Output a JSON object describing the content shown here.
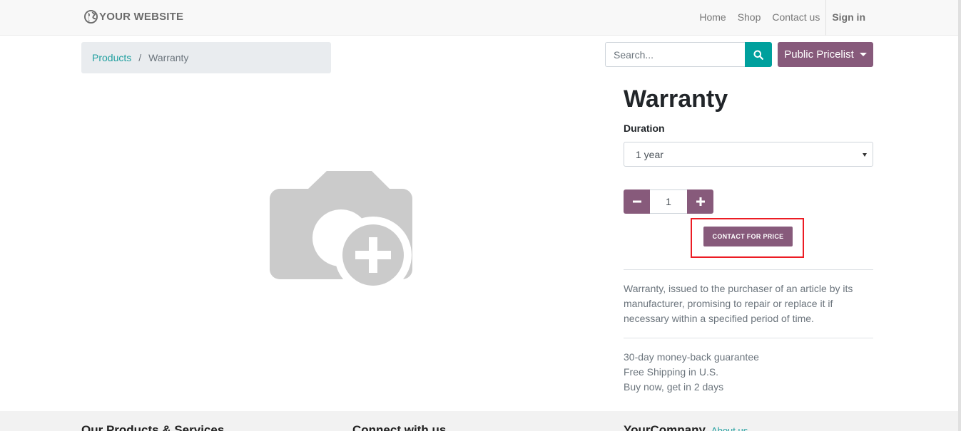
{
  "navbar": {
    "brand": "YOUR WEBSITE",
    "links": [
      "Home",
      "Shop",
      "Contact us"
    ],
    "signin": "Sign in"
  },
  "breadcrumb": {
    "parent": "Products",
    "separator": "/",
    "current": "Warranty"
  },
  "search": {
    "placeholder": "Search...",
    "value": ""
  },
  "pricelist": {
    "label": "Public Pricelist"
  },
  "product": {
    "title": "Warranty",
    "attribute_label": "Duration",
    "attribute_value": "1 year",
    "quantity": "1",
    "contact_label": "CONTACT FOR PRICE",
    "description": "Warranty, issued to the purchaser of an article by its manufacturer, promising to repair or replace it if necessary within a specified period of time.",
    "terms": [
      "30-day money-back guarantee",
      "Free Shipping in U.S.",
      "Buy now, get in 2 days"
    ]
  },
  "footer": {
    "col1": "Our Products & Services",
    "col2": "Connect with us",
    "col3": "YourCompany",
    "col3_link": "About us"
  },
  "colors": {
    "primary": "#875a7b",
    "accent": "#00a09d",
    "highlight": "#ec1c24"
  }
}
